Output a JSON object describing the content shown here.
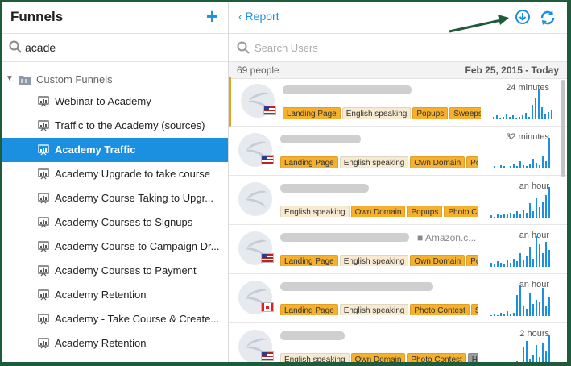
{
  "left_panel": {
    "title": "Funnels",
    "add_icon": "plus-icon",
    "search": {
      "value": "acade"
    },
    "group": {
      "label": "Custom Funnels"
    },
    "items": [
      {
        "label": "Webinar to Academy"
      },
      {
        "label": "Traffic to the Academy (sources)"
      },
      {
        "label": "Academy Traffic"
      },
      {
        "label": "Academy Upgrade to take course"
      },
      {
        "label": "Academy Course Taking to Upgr..."
      },
      {
        "label": "Academy Courses to Signups"
      },
      {
        "label": "Academy Course to Campaign Dr..."
      },
      {
        "label": "Academy Courses to Payment"
      },
      {
        "label": "Academy Retention"
      },
      {
        "label": "Academy - Take Course & Create..."
      },
      {
        "label": "Academy Retention"
      }
    ],
    "active_index": 2
  },
  "right_panel": {
    "back_label": "‹ Report",
    "search_placeholder": "Search Users",
    "count": "69 people",
    "date_range": "Feb 25, 2015 - Today",
    "users": [
      {
        "time": "24 minutes",
        "flag": "us",
        "company": "",
        "tags": [
          {
            "text": "Landing Page",
            "style": "orange"
          },
          {
            "text": "English speaking",
            "style": "pale"
          },
          {
            "text": "Popups",
            "style": "orange"
          },
          {
            "text": "Sweepstakes",
            "style": "orange"
          }
        ],
        "activity": [
          2,
          3,
          1,
          2,
          4,
          2,
          3,
          1,
          2,
          3,
          5,
          2,
          12,
          18,
          25,
          10,
          4,
          6,
          8
        ]
      },
      {
        "time": "32 minutes",
        "flag": "us",
        "company": "",
        "tags": [
          {
            "text": "Landing Page",
            "style": "orange"
          },
          {
            "text": "English speaking",
            "style": "pale"
          },
          {
            "text": "Own Domain",
            "style": "orange"
          },
          {
            "text": "Popups",
            "style": "orange"
          }
        ],
        "activity": [
          1,
          2,
          1,
          3,
          2,
          1,
          2,
          4,
          2,
          6,
          3,
          2,
          4,
          8,
          5,
          3,
          10,
          6,
          26
        ]
      },
      {
        "time": "an hour",
        "flag": "",
        "company": "",
        "tags": [
          {
            "text": "English speaking",
            "style": "pale"
          },
          {
            "text": "Own Domain",
            "style": "orange"
          },
          {
            "text": "Popups",
            "style": "orange"
          },
          {
            "text": "Photo Contest",
            "style": "orange"
          }
        ],
        "activity": [
          2,
          1,
          3,
          2,
          4,
          3,
          5,
          4,
          6,
          3,
          8,
          5,
          14,
          6,
          20,
          10,
          15,
          22,
          30
        ]
      },
      {
        "time": "an hour",
        "flag": "us",
        "company": "Amazon.c...",
        "tags": [
          {
            "text": "Landing Page",
            "style": "orange"
          },
          {
            "text": "English speaking",
            "style": "pale"
          },
          {
            "text": "Own Domain",
            "style": "orange"
          },
          {
            "text": "Popups",
            "style": "orange"
          }
        ],
        "activity": [
          3,
          2,
          4,
          3,
          2,
          5,
          3,
          6,
          4,
          10,
          5,
          8,
          14,
          6,
          22,
          16,
          10,
          18,
          12
        ]
      },
      {
        "time": "an hour",
        "flag": "ca",
        "company": "",
        "tags": [
          {
            "text": "Landing Page",
            "style": "orange"
          },
          {
            "text": "English speaking",
            "style": "pale"
          },
          {
            "text": "Photo Contest",
            "style": "orange"
          },
          {
            "text": "Sweepstakes",
            "style": "orange"
          }
        ],
        "activity": [
          1,
          2,
          1,
          3,
          2,
          4,
          2,
          3,
          18,
          26,
          8,
          6,
          20,
          10,
          14,
          12,
          24,
          8,
          16
        ]
      },
      {
        "time": "2 hours",
        "flag": "us",
        "company": "",
        "tags": [
          {
            "text": "English speaking",
            "style": "pale"
          },
          {
            "text": "Own Domain",
            "style": "orange"
          },
          {
            "text": "Photo Contest",
            "style": "orange"
          },
          {
            "text": "Hot lead",
            "style": "gray"
          }
        ],
        "activity": [
          2,
          1,
          2,
          3,
          1,
          2,
          3,
          2,
          4,
          3,
          18,
          24,
          6,
          10,
          20,
          8,
          22,
          14,
          30
        ]
      }
    ]
  },
  "colors": {
    "accent": "#1b8fe0",
    "tag_orange": "#f5b02e",
    "tag_pale": "#f7ead0",
    "frame": "#1e5b3a"
  }
}
